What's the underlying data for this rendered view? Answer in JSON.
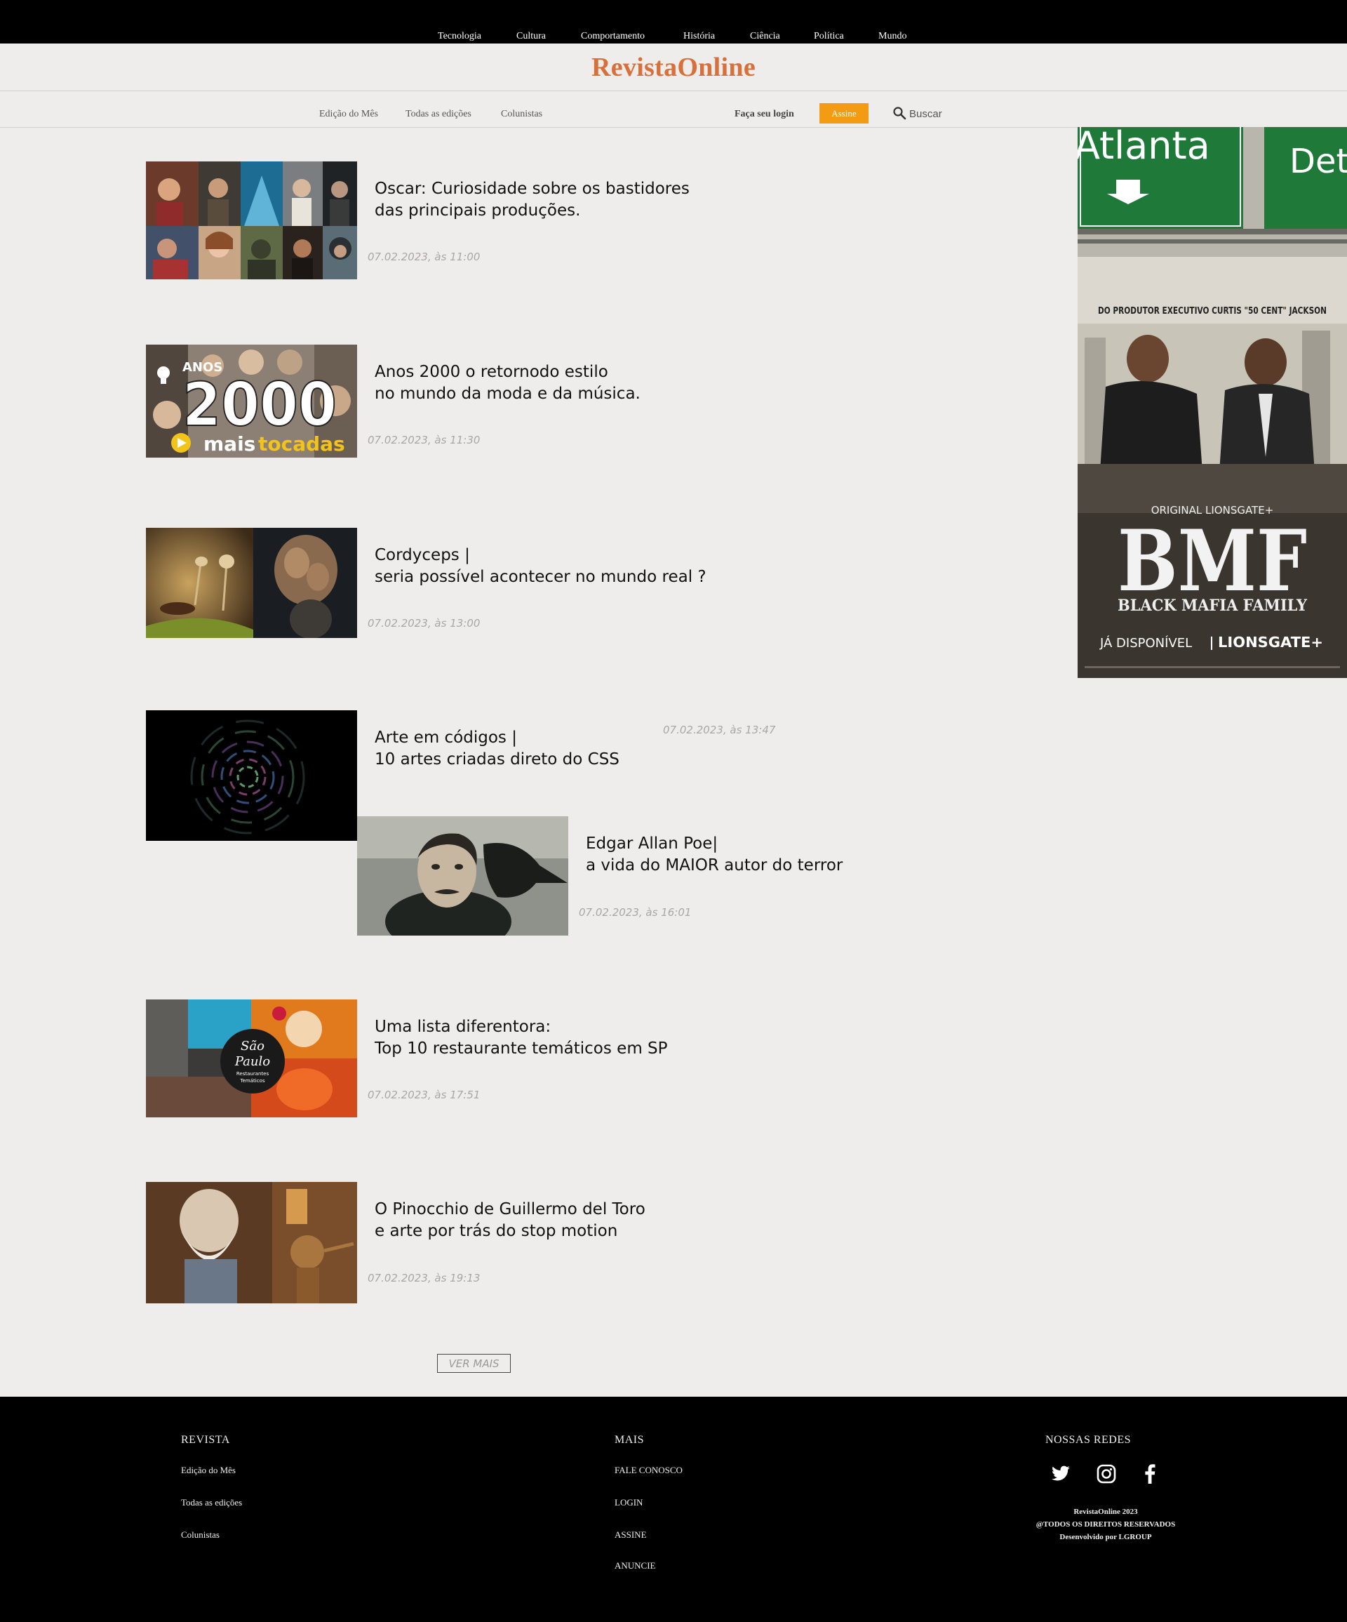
{
  "top_nav": [
    "Tecnologia",
    "Cultura",
    "Comportamento",
    "História",
    "Ciência",
    "Política",
    "Mundo"
  ],
  "logo": "RevistaOnline",
  "sub_nav": [
    "Edição do Mês",
    "Todas as edições",
    "Colunistas"
  ],
  "account": {
    "login_label": "Faça seu login",
    "subscribe_label": "Assine"
  },
  "search": {
    "label": "Buscar",
    "icon": "search-icon"
  },
  "articles": [
    {
      "title_line1": "Oscar: Curiosidade sobre os bastidores",
      "title_line2": "das principais produções.",
      "date": "07.02.2023, às 11:00"
    },
    {
      "title_line1": "Anos 2000 o retornodo estilo",
      "title_line2": "no mundo da moda e da música.",
      "date": "07.02.2023, às 11:30"
    },
    {
      "title_line1": "Cordyceps |",
      "title_line2": "seria possível acontecer no mundo real ?",
      "date": "07.02.2023, às 13:00"
    },
    {
      "title_line1": "Arte em códigos |",
      "title_line2": "10 artes criadas direto do CSS",
      "date": "07.02.2023, às 13:47"
    },
    {
      "title_line1": "Edgar Allan Poe|",
      "title_line2": "a vida do MAIOR autor do terror",
      "date": "07.02.2023, às 16:01"
    },
    {
      "title_line1": "Uma lista diferentora:",
      "title_line2": "Top 10 restaurante temáticos em SP",
      "date": "07.02.2023, às 17:51"
    },
    {
      "title_line1": "O Pinocchio de Guillermo del Toro",
      "title_line2": "e arte por trás do stop motion",
      "date": "07.02.2023, às 19:13"
    }
  ],
  "thumb_text": {
    "anos": "ANOS",
    "year": "2000",
    "mais": "mais",
    "tocadas": "tocadas",
    "sao_paulo_1": "São",
    "sao_paulo_2": "Paulo",
    "restaurantes": "Restaurantes",
    "tematicos": "Temáticos"
  },
  "ad": {
    "sign_left": "Atlanta",
    "sign_right": "Det",
    "producer": "DO PRODUTOR EXECUTIVO CURTIS \"50 CENT\" JACKSON",
    "original": "ORIGINAL LIONSGATE+",
    "title": "BMF",
    "subtitle": "BLACK MAFIA FAMILY",
    "available": "JÁ DISPONÍVEL",
    "brand": "LIONSGATE+"
  },
  "more_button": "VER MAIS",
  "footer": {
    "col1": {
      "heading": "REVISTA",
      "links": [
        "Edição do Mês",
        "Todas as edições",
        "Colunistas"
      ]
    },
    "col2": {
      "heading": "MAIS",
      "links": [
        "FALE CONOSCO",
        "LOGIN",
        "ASSINE",
        "ANUNCIE"
      ]
    },
    "col3": {
      "heading": "NOSSAS REDES",
      "social": [
        "twitter-icon",
        "instagram-icon",
        "facebook-icon"
      ]
    },
    "copyright_1": "RevistaOnline 2023",
    "copyright_2": "@TODOS OS DIREITOS RESERVADOS",
    "copyright_3": "Desenvolvido por LGROUP"
  },
  "colors": {
    "accent": "#d8703b",
    "button": "#f39c13",
    "background": "#efedeb",
    "dark": "#000000"
  }
}
